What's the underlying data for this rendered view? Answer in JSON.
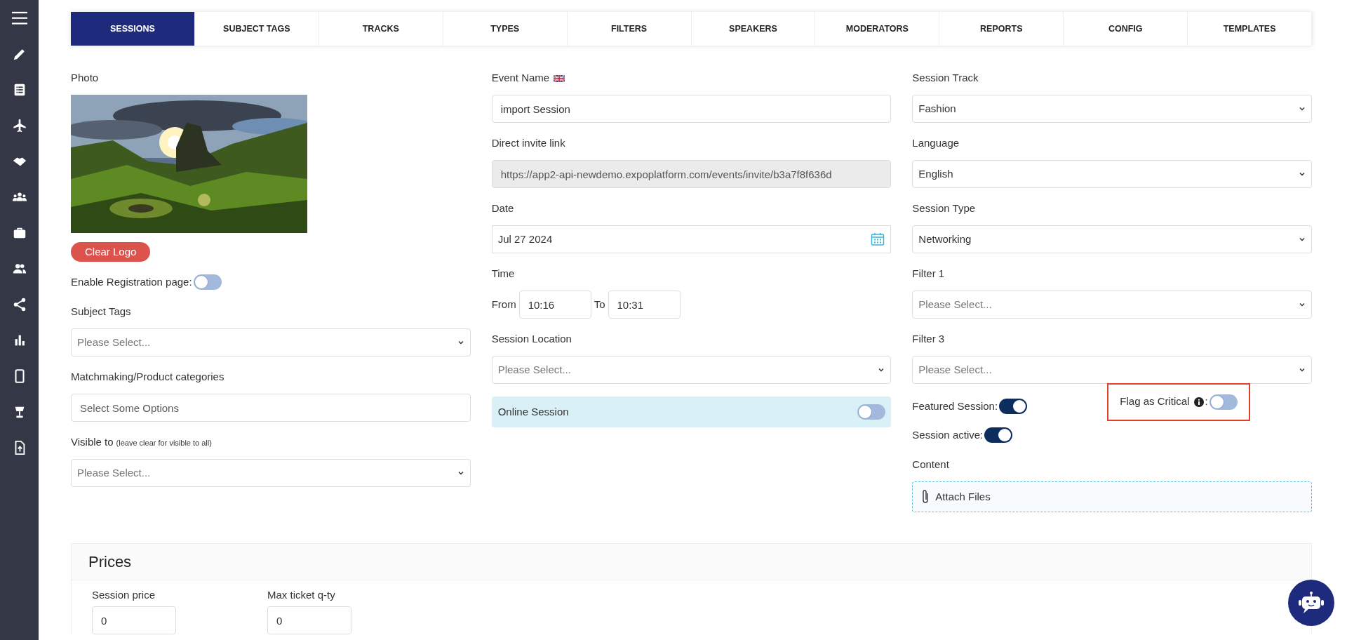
{
  "tabs": [
    {
      "label": "SESSIONS",
      "selected": true
    },
    {
      "label": "SUBJECT TAGS",
      "selected": false
    },
    {
      "label": "TRACKS",
      "selected": false
    },
    {
      "label": "TYPES",
      "selected": false
    },
    {
      "label": "FILTERS",
      "selected": false
    },
    {
      "label": "SPEAKERS",
      "selected": false
    },
    {
      "label": "MODERATORS",
      "selected": false
    },
    {
      "label": "REPORTS",
      "selected": false
    },
    {
      "label": "CONFIG",
      "selected": false
    },
    {
      "label": "TEMPLATES",
      "selected": false
    }
  ],
  "columns": [
    [
      {
        "label": "Photo",
        "button": "Clear Logo"
      },
      {
        "kind": "toggle",
        "label": "Enable Registration page:",
        "on": false
      },
      {
        "kind": "select",
        "label": "Subject Tags",
        "placeholder": "Please Select..."
      },
      {
        "kind": "input",
        "label": "Matchmaking/Product categories",
        "placeholder": "Select Some Options"
      },
      {
        "kind": "select",
        "label": "Visible to",
        "note": "(leave clear for visible to all)",
        "placeholder": "Please Select..."
      }
    ],
    [
      {
        "kind": "input",
        "label": "Event Name",
        "flag": true,
        "value": "import Session"
      },
      {
        "kind": "input",
        "label": "Direct invite link",
        "value": "https://app2-api-newdemo.expoplatform.com/events/invite/b3a7f8f636d",
        "disabled": true
      },
      {
        "kind": "date",
        "label": "Date",
        "value": "Jul 27 2024"
      },
      {
        "kind": "time",
        "label": "Time",
        "from_label": "From",
        "from": "10:16",
        "to_label": "To",
        "to": "10:31"
      },
      {
        "kind": "select",
        "label": "Session Location",
        "placeholder": "Please Select..."
      },
      {
        "kind": "banner_toggle",
        "label": "Online Session",
        "on": false
      }
    ],
    [
      {
        "kind": "select",
        "label": "Session Track",
        "value": "Fashion"
      },
      {
        "kind": "select",
        "label": "Language",
        "value": "English"
      },
      {
        "kind": "select",
        "label": "Session Type",
        "value": "Networking"
      },
      {
        "kind": "select",
        "label": "Filter 1",
        "placeholder": "Please Select..."
      },
      {
        "kind": "select",
        "label": "Filter 3",
        "placeholder": "Please Select..."
      },
      {
        "kind": "toggle_pair",
        "items": [
          {
            "label": "Featured Session:",
            "on": true,
            "highlighted": false
          },
          {
            "label": "Flag as Critical",
            "info": true,
            "after": ":",
            "on": false,
            "highlighted": true
          }
        ]
      },
      {
        "kind": "toggle",
        "label": "Session active:",
        "on": true
      },
      {
        "kind": "upload",
        "label": "Content",
        "button": "Attach Files"
      }
    ]
  ],
  "prices": {
    "title": "Prices",
    "fields": [
      {
        "label": "Session price",
        "value": "0"
      },
      {
        "label": "Max ticket q-ty",
        "value": "0"
      }
    ]
  }
}
